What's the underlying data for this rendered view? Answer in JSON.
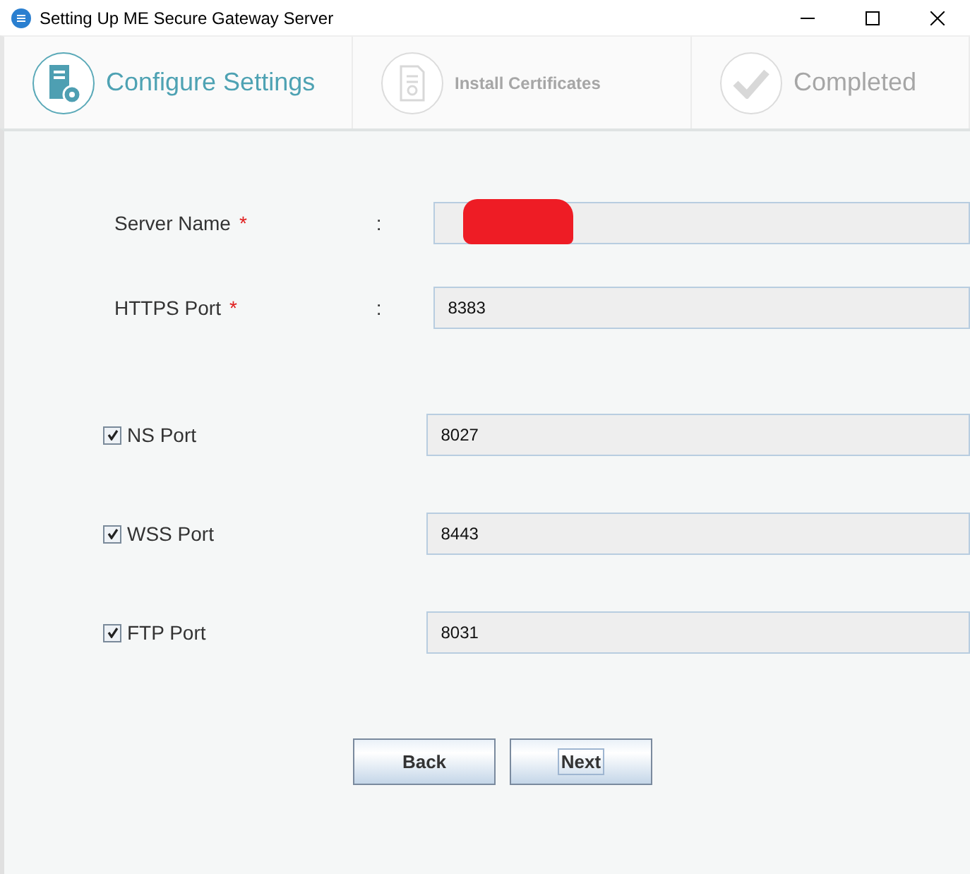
{
  "window": {
    "title": "Setting Up ME Secure Gateway Server"
  },
  "steps": [
    {
      "kind": "configure",
      "label": "Configure Settings",
      "selected": true
    },
    {
      "kind": "certificate",
      "label": "Install Certificates",
      "selected": false
    },
    {
      "kind": "completed",
      "label": "Completed",
      "selected": false
    }
  ],
  "fields": [
    {
      "kind": "required",
      "label": "Server Name",
      "mark": "*",
      "separator": ":",
      "redacted": true
    },
    {
      "kind": "required",
      "label": "HTTPS Port",
      "mark": "*",
      "separator": ":",
      "value": "8383"
    },
    {
      "kind": "optional",
      "label": "NS Port",
      "checked": true,
      "value": "8027"
    },
    {
      "kind": "optional",
      "label": "WSS Port",
      "checked": true,
      "value": "8443"
    },
    {
      "kind": "optional",
      "label": "FTP Port",
      "checked": true,
      "value": "8031"
    }
  ],
  "buttons": [
    {
      "label": "Back",
      "focused": false
    },
    {
      "label": "Next",
      "focused": true
    }
  ]
}
